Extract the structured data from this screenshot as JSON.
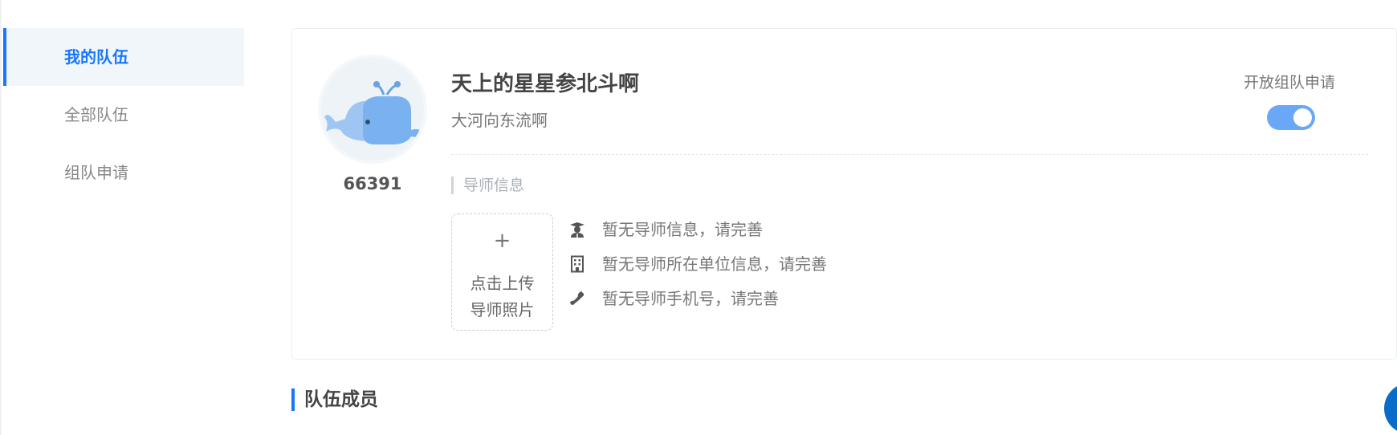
{
  "sidebar": {
    "items": [
      {
        "label": "我的队伍",
        "active": true
      },
      {
        "label": "全部队伍",
        "active": false
      },
      {
        "label": "组队申请",
        "active": false
      }
    ]
  },
  "team": {
    "id": "66391",
    "name": "天上的星星参北斗啊",
    "description": "大河向东流啊",
    "apply_label": "开放组队申请",
    "apply_enabled": true,
    "avatar_icon": "whale-avatar"
  },
  "mentor": {
    "section_label": "导师信息",
    "upload": {
      "plus": "+",
      "line1": "点击上传",
      "line2": "导师照片"
    },
    "info": [
      {
        "icon": "graduate-icon",
        "text": "暂无导师信息，请完善"
      },
      {
        "icon": "building-icon",
        "text": "暂无导师所在单位信息，请完善"
      },
      {
        "icon": "phone-icon",
        "text": "暂无导师手机号，请完善"
      }
    ]
  },
  "members": {
    "title": "队伍成员"
  },
  "colors": {
    "accent": "#1677ff",
    "toggle_on": "#6aa8f7",
    "float_button": "#0a6cc9"
  }
}
